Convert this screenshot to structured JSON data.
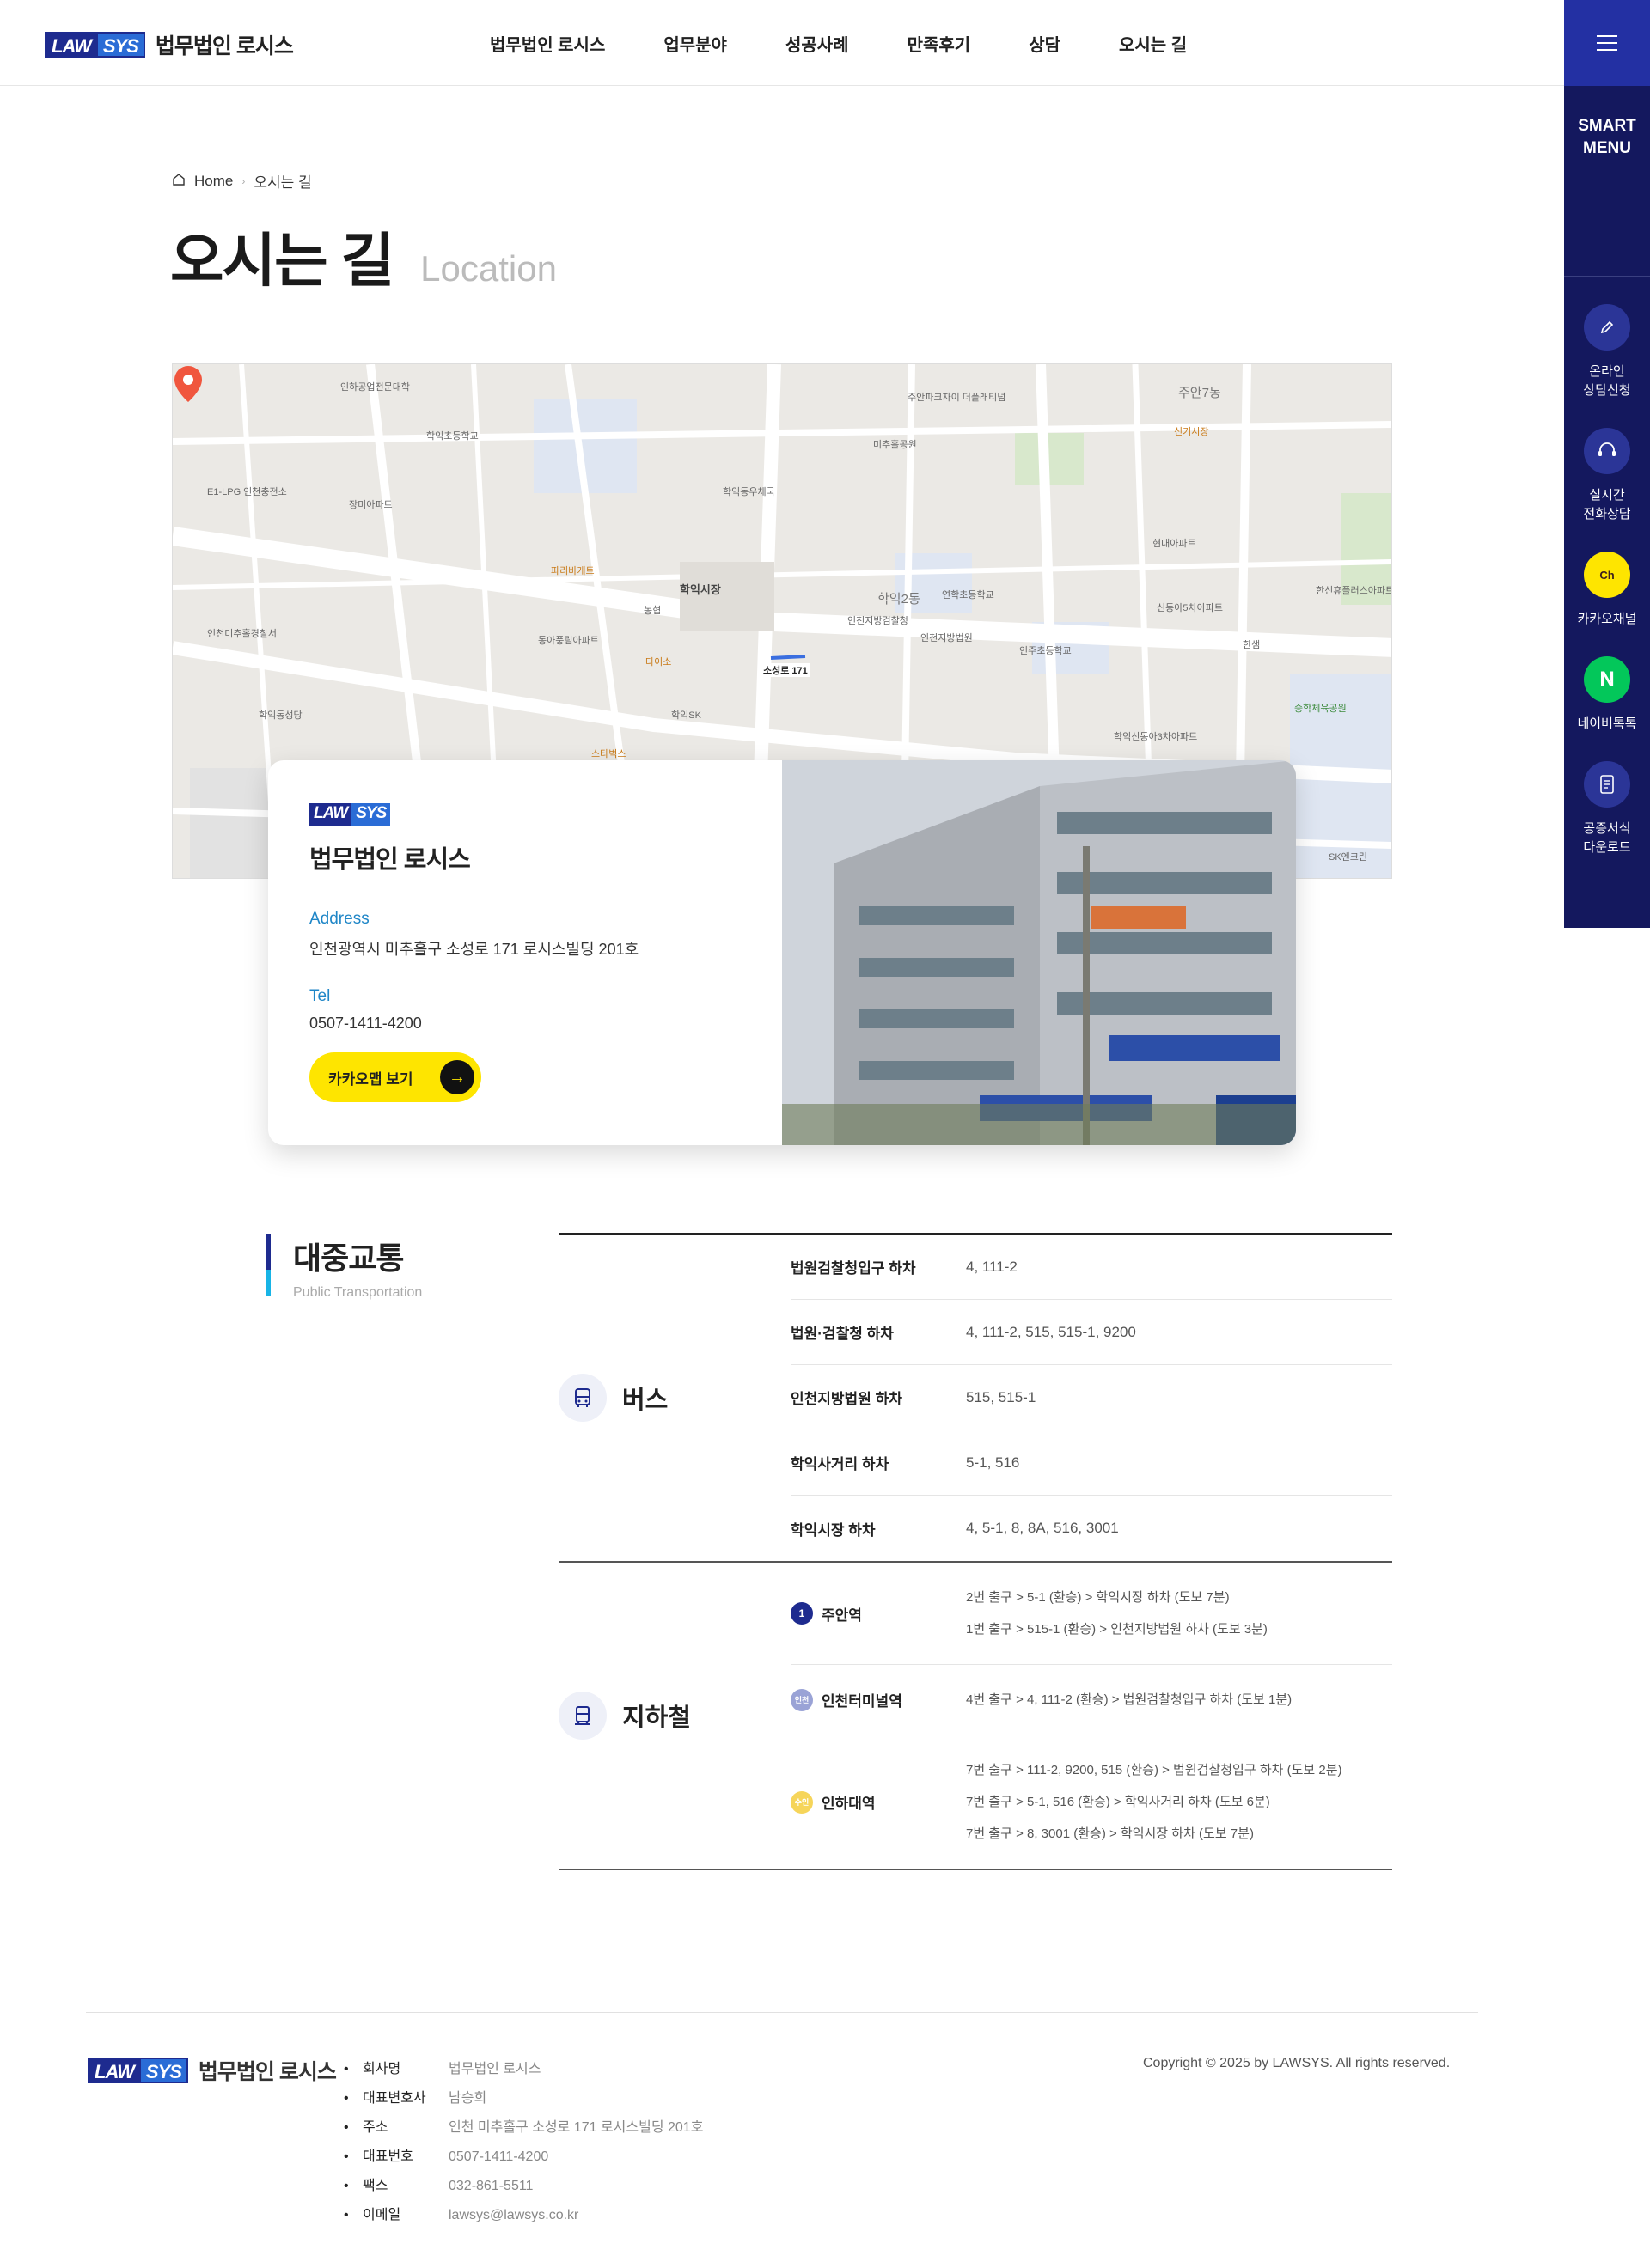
{
  "header": {
    "logo_mark_1": "LAW",
    "logo_mark_2": "SYS",
    "logo_text": "법무법인 로시스",
    "nav": [
      "법무법인 로시스",
      "업무분야",
      "성공사례",
      "만족후기",
      "상담",
      "오시는 길"
    ]
  },
  "quick_menu": {
    "title": "SMART\nMENU",
    "items": [
      {
        "label": "온라인\n상담신청",
        "icon": "pencil-icon"
      },
      {
        "label": "실시간\n전화상담",
        "icon": "headset-icon"
      },
      {
        "label": "카카오채널",
        "icon": "kakao-channel-icon",
        "glyph": "Ch"
      },
      {
        "label": "네이버톡톡",
        "icon": "naver-icon",
        "glyph": "N"
      },
      {
        "label": "공증서식\n다운로드",
        "icon": "document-icon"
      }
    ]
  },
  "breadcrumb": {
    "home": "Home",
    "current": "오시는 길"
  },
  "page_title": {
    "ko": "오시는 길",
    "en": "Location"
  },
  "map": {
    "pin_label": "소성로 171",
    "labels": [
      "학익시장",
      "학익2동",
      "주안7동",
      "인천지방검찰청",
      "학익SK",
      "신기시장",
      "미추홀공원",
      "학익동우체국",
      "인주초등학교",
      "연학초등학교",
      "학익초등학교",
      "인하공업전문대학",
      "인천지방법원",
      "승학체육공원",
      "한신휴플러스아파트",
      "장미아파트",
      "동아풍림아파트",
      "다이소",
      "농협",
      "파리바게트",
      "스타벅스",
      "SK엔크린",
      "E1-LPG 인천충전소",
      "인천미추홀경찰서",
      "학익동성당",
      "신동아5차아파트",
      "현대아파트",
      "한샘",
      "학익신동아3차아파트",
      "주안파크자이 더플래티넘"
    ]
  },
  "card": {
    "logo_mark_1": "LAW",
    "logo_mark_2": "SYS",
    "name": "법무법인 로시스",
    "address_label": "Address",
    "address": "인천광역시 미추홀구 소성로 171 로시스빌딩 201호",
    "tel_label": "Tel",
    "tel": "0507-1411-4200",
    "button": "카카오맵 보기"
  },
  "transport": {
    "title": "대중교통",
    "subtitle": "Public Transportation",
    "bus": {
      "label": "버스",
      "icon": "bus-icon",
      "rows": [
        {
          "stop": "법원검찰청입구 하차",
          "lines": "4, 111-2"
        },
        {
          "stop": "법원·검찰청 하차",
          "lines": "4, 111-2, 515, 515-1, 9200"
        },
        {
          "stop": "인천지방법원 하차",
          "lines": "515, 515-1"
        },
        {
          "stop": "학익사거리 하차",
          "lines": "5-1, 516"
        },
        {
          "stop": "학익시장 하차",
          "lines": "4, 5-1, 8, 8A, 516, 3001"
        }
      ]
    },
    "subway": {
      "label": "지하철",
      "icon": "subway-icon",
      "rows": [
        {
          "badge": "1",
          "station": "주안역",
          "paths": [
            "2번 출구 > 5-1 (환승) > 학익시장 하차 (도보 7분)",
            "1번 출구 > 515-1 (환승) > 인천지방법원 하차 (도보 3분)"
          ]
        },
        {
          "badge": "인천",
          "station": "인천터미널역",
          "paths": [
            "4번 출구 > 4, 111-2 (환승) > 법원검찰청입구 하차 (도보 1분)"
          ]
        },
        {
          "badge": "수인",
          "station": "인하대역",
          "paths": [
            "7번 출구 > 111-2, 9200, 515 (환승) > 법원검찰청입구 하차 (도보 2분)",
            "7번 출구 > 5-1, 516 (환승) > 학익사거리 하차 (도보 6분)",
            "7번 출구 > 8, 3001 (환승) > 학익시장 하차 (도보 7분)"
          ]
        }
      ]
    }
  },
  "footer": {
    "logo_mark_1": "LAW",
    "logo_mark_2": "SYS",
    "logo_text": "법무법인 로시스",
    "info": [
      {
        "k": "회사명",
        "v": "법무법인 로시스"
      },
      {
        "k": "대표변호사",
        "v": "남승희"
      },
      {
        "k": "주소",
        "v": "인천 미추홀구 소성로 171 로시스빌딩 201호"
      },
      {
        "k": "대표번호",
        "v": "0507-1411-4200"
      },
      {
        "k": "팩스",
        "v": "032-861-5511"
      },
      {
        "k": "이메일",
        "v": "lawsys@lawsys.co.kr"
      }
    ],
    "copyright": "Copyright © 2025 by LAWSYS. All rights reserved."
  },
  "colors": {
    "brand_navy": "#1e2b8f",
    "quick_bg": "#14185e",
    "accent_blue": "#1f86c7",
    "kakao_yellow": "#fee500"
  }
}
